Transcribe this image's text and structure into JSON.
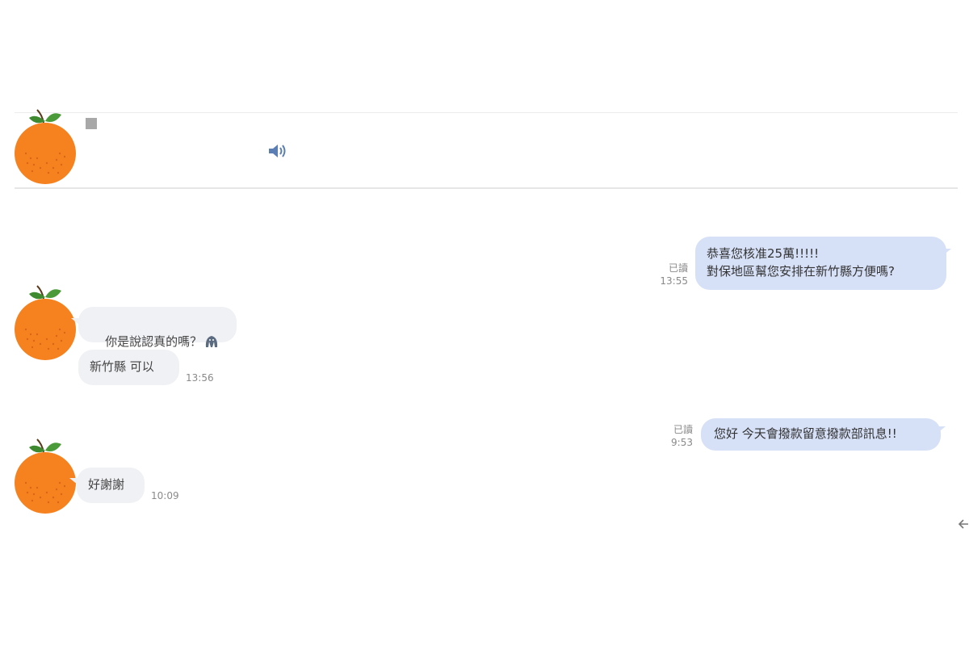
{
  "header": {
    "contact_name_masked": true,
    "speaker_icon": "speaker-icon"
  },
  "messages": [
    {
      "direction": "out",
      "text": "恭喜您核准25萬!!!!!\n對保地區幫您安排在新竹縣方便嗎?",
      "read": "已讀",
      "time": "13:55"
    },
    {
      "direction": "in",
      "text": "你是說認真的嗎？",
      "sticker": "sticker-icon"
    },
    {
      "direction": "in",
      "text": "新竹縣 可以",
      "time": "13:56"
    },
    {
      "direction": "out",
      "text": "您好 今天會撥款留意撥款部訊息!!",
      "read": "已讀",
      "time": "9:53"
    },
    {
      "direction": "in",
      "text": "好謝謝",
      "time": "10:09"
    }
  ],
  "colors": {
    "outgoing_bubble": "#d6e0f7",
    "incoming_bubble": "#f0f1f4",
    "avatar_orange": "#f5821f",
    "leaf_green": "#4a9a3a"
  },
  "icons": {
    "avatar": "orange-avatar-icon",
    "back": "back-arrow-icon"
  }
}
